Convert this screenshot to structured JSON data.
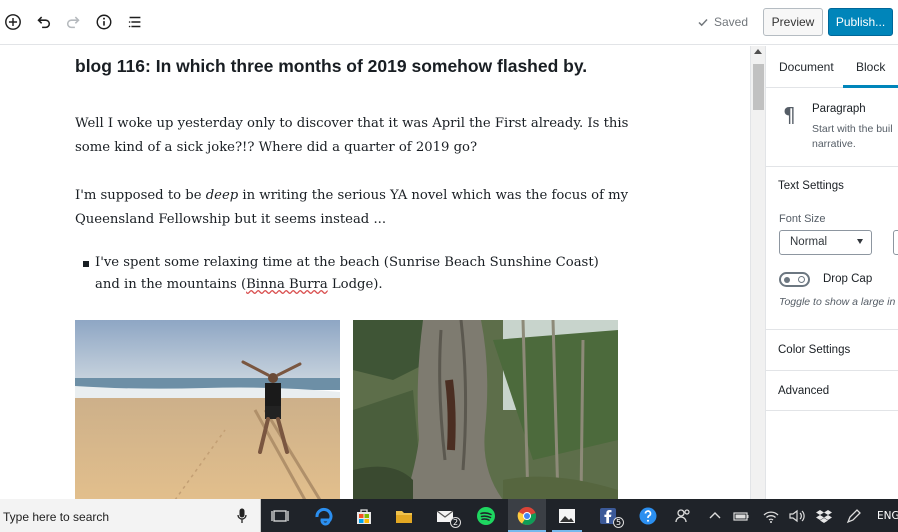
{
  "toolbar": {
    "saved_label": "Saved",
    "preview_label": "Preview",
    "publish_label": "Publish...",
    "icons": [
      "add-block-icon",
      "undo-icon",
      "redo-icon",
      "info-icon",
      "outline-icon"
    ]
  },
  "post": {
    "title": "blog 116: In which three months of 2019 somehow flashed by.",
    "paragraph1": "Well I woke up yesterday only to discover that it was April the First already. Is this some kind of a sick joke?!? Where did a quarter of 2019 go?",
    "paragraph2_before": "I'm supposed to be ",
    "paragraph2_em": "deep",
    "paragraph2_after": " in writing the serious YA novel which was the focus of my Queensland Fellowship but it seems instead ...",
    "list_item_before": "I've spent some relaxing time at the beach (Sunrise Beach Sunshine Coast) and in the mountains (",
    "list_item_misspelled": "Binna Burra",
    "list_item_after": " Lodge)."
  },
  "sidebar": {
    "tab_document": "Document",
    "tab_block": "Block",
    "active_tab": "Block",
    "block_icon_glyph": "¶",
    "block_name": "Paragraph",
    "block_desc_line1": "Start with the buil",
    "block_desc_line2": "narrative.",
    "text_settings_title": "Text Settings",
    "font_size_label": "Font Size",
    "font_size_value": "Normal",
    "drop_cap_label": "Drop Cap",
    "drop_cap_help": "Toggle to show a large in",
    "color_settings_title": "Color Settings",
    "advanced_title": "Advanced"
  },
  "taskbar": {
    "search_placeholder": "Type here to search",
    "mail_badge": "2",
    "facebook_badge": "5",
    "language": "ENG",
    "active_app": "chrome"
  },
  "colors": {
    "publish_bg": "#0085ba",
    "tab_active_underline": "#0085ba",
    "taskbar_bg": "#1f2329"
  }
}
